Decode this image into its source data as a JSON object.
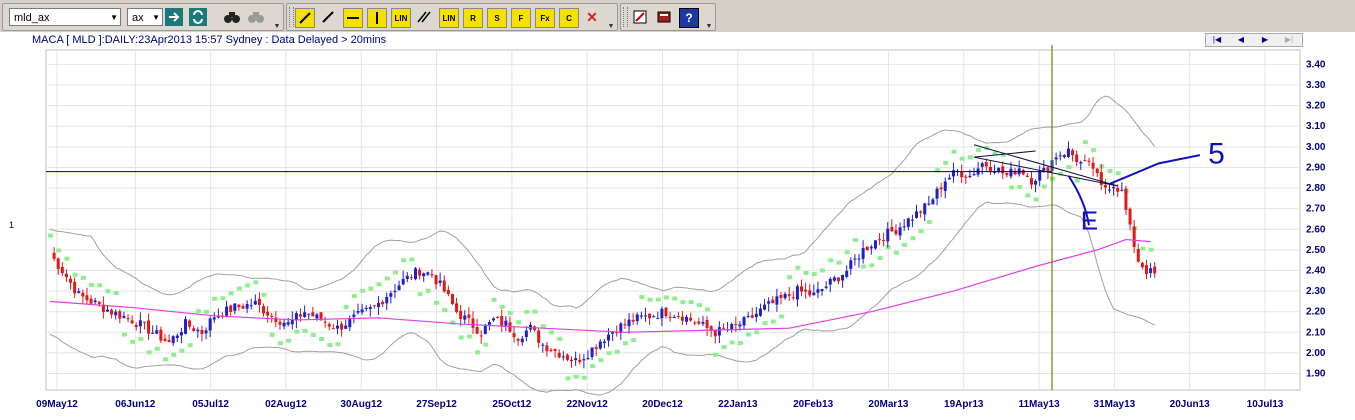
{
  "toolbar": {
    "symbol_value": "mld_ax",
    "exchange_value": "ax",
    "buttons": [
      {
        "name": "go-arrow-icon",
        "label": "→",
        "color": "#1a7a7a"
      },
      {
        "name": "refresh-icon",
        "label": "⟳",
        "color": "#1a7a7a"
      },
      {
        "name": "binoculars-icon",
        "label": "🔭",
        "color": "#222"
      },
      {
        "name": "binoculars-disabled-icon",
        "label": "🔭",
        "color": "#999"
      }
    ],
    "draw_tools": [
      {
        "name": "draw-trend-icon",
        "label": "↗"
      },
      {
        "name": "draw-line-icon",
        "label": "/"
      },
      {
        "name": "draw-hline-icon",
        "label": "—"
      },
      {
        "name": "draw-vline-icon",
        "label": "|"
      },
      {
        "name": "draw-lin-icon",
        "label": "LIN"
      },
      {
        "name": "draw-parallel-icon",
        "label": "//"
      },
      {
        "name": "draw-lin2-icon",
        "label": "LIN"
      },
      {
        "name": "draw-r-icon",
        "label": "R"
      },
      {
        "name": "draw-s-icon",
        "label": "S"
      },
      {
        "name": "draw-f-icon",
        "label": "F"
      },
      {
        "name": "draw-fx-icon",
        "label": "Fx"
      },
      {
        "name": "draw-c-icon",
        "label": "C"
      },
      {
        "name": "delete-drawing-icon",
        "label": "✕"
      }
    ],
    "misc_tools": [
      {
        "name": "chart-edit-icon",
        "label": "✎"
      },
      {
        "name": "book-icon",
        "label": "📕"
      },
      {
        "name": "help-icon",
        "label": "?"
      }
    ]
  },
  "chart": {
    "title": "MACA [ MLD ]:DAILY:23Apr2013 15:57 Sydney : Data Delayed > 20mins",
    "row_marker": "1",
    "nav": [
      "|◀",
      "◀",
      "▶",
      "▶|"
    ]
  },
  "chart_data": {
    "type": "candlestick",
    "title": "MACA [ MLD ]:DAILY:23Apr2013 15:57 Sydney : Data Delayed > 20mins",
    "ylim": [
      1.82,
      3.47
    ],
    "y_ticks": [
      "3.40",
      "3.30",
      "3.20",
      "3.10",
      "3.00",
      "2.90",
      "2.80",
      "2.70",
      "2.60",
      "2.50",
      "2.40",
      "2.30",
      "2.20",
      "2.10",
      "2.00",
      "1.90"
    ],
    "x_ticks": [
      "09May12",
      "06Jun12",
      "05Jul12",
      "02Aug12",
      "30Aug12",
      "27Sep12",
      "25Oct12",
      "22Nov12",
      "20Dec12",
      "22Jan13",
      "20Feb13",
      "20Mar13",
      "19Apr13",
      "11May13",
      "31May13",
      "20Jun13",
      "10Jul13"
    ],
    "grid": true,
    "colors": {
      "up": "#2020c8",
      "down": "#e01818",
      "ma": "#e040e0",
      "psar": "#90ee90",
      "bands": "#a0a0a0",
      "hline": "#000050",
      "vline": "#5a8a00",
      "annotation": "#1010c0"
    },
    "close_path": [
      [
        0,
        2.48
      ],
      [
        3,
        2.4
      ],
      [
        7,
        2.28
      ],
      [
        11,
        2.24
      ],
      [
        15,
        2.2
      ],
      [
        20,
        2.16
      ],
      [
        25,
        2.1
      ],
      [
        29,
        2.05
      ],
      [
        33,
        2.14
      ],
      [
        37,
        2.1
      ],
      [
        40,
        2.18
      ],
      [
        45,
        2.22
      ],
      [
        50,
        2.24
      ],
      [
        54,
        2.18
      ],
      [
        58,
        2.14
      ],
      [
        62,
        2.2
      ],
      [
        66,
        2.16
      ],
      [
        70,
        2.12
      ],
      [
        75,
        2.18
      ],
      [
        79,
        2.22
      ],
      [
        82,
        2.28
      ],
      [
        86,
        2.35
      ],
      [
        90,
        2.4
      ],
      [
        93,
        2.38
      ],
      [
        96,
        2.3
      ],
      [
        99,
        2.2
      ],
      [
        102,
        2.15
      ],
      [
        105,
        2.1
      ],
      [
        108,
        2.16
      ],
      [
        111,
        2.14
      ],
      [
        114,
        2.08
      ],
      [
        117,
        2.12
      ],
      [
        120,
        2.04
      ],
      [
        124,
        2.0
      ],
      [
        128,
        1.96
      ],
      [
        131,
        2.0
      ],
      [
        134,
        2.06
      ],
      [
        138,
        2.12
      ],
      [
        142,
        2.16
      ],
      [
        146,
        2.18
      ],
      [
        150,
        2.2
      ],
      [
        154,
        2.18
      ],
      [
        158,
        2.14
      ],
      [
        162,
        2.1
      ],
      [
        166,
        2.12
      ],
      [
        170,
        2.16
      ],
      [
        174,
        2.22
      ],
      [
        178,
        2.26
      ],
      [
        182,
        2.3
      ],
      [
        186,
        2.28
      ],
      [
        190,
        2.34
      ],
      [
        194,
        2.4
      ],
      [
        198,
        2.5
      ],
      [
        202,
        2.56
      ],
      [
        206,
        2.6
      ],
      [
        210,
        2.66
      ],
      [
        214,
        2.72
      ],
      [
        218,
        2.84
      ],
      [
        221,
        2.88
      ],
      [
        224,
        2.86
      ],
      [
        227,
        2.92
      ],
      [
        230,
        2.9
      ],
      [
        233,
        2.86
      ],
      [
        236,
        2.9
      ],
      [
        239,
        2.84
      ],
      [
        242,
        2.88
      ],
      [
        245,
        2.96
      ],
      [
        248,
        2.98
      ],
      [
        251,
        2.92
      ],
      [
        254,
        2.9
      ],
      [
        256,
        2.8
      ],
      [
        259,
        2.82
      ],
      [
        261,
        2.78
      ],
      [
        263,
        2.6
      ],
      [
        265,
        2.45
      ],
      [
        267,
        2.4
      ],
      [
        269,
        2.38
      ]
    ],
    "ma_points": [
      [
        0,
        2.25
      ],
      [
        20,
        2.22
      ],
      [
        40,
        2.18
      ],
      [
        60,
        2.16
      ],
      [
        80,
        2.17
      ],
      [
        100,
        2.14
      ],
      [
        120,
        2.12
      ],
      [
        140,
        2.1
      ],
      [
        160,
        2.11
      ],
      [
        180,
        2.12
      ],
      [
        200,
        2.2
      ],
      [
        220,
        2.3
      ],
      [
        240,
        2.42
      ],
      [
        255,
        2.5
      ],
      [
        262,
        2.55
      ],
      [
        268,
        2.54
      ]
    ],
    "horizontal_line": 2.88,
    "vertical_line_index": 244,
    "annotations": [
      "E",
      "5"
    ]
  }
}
